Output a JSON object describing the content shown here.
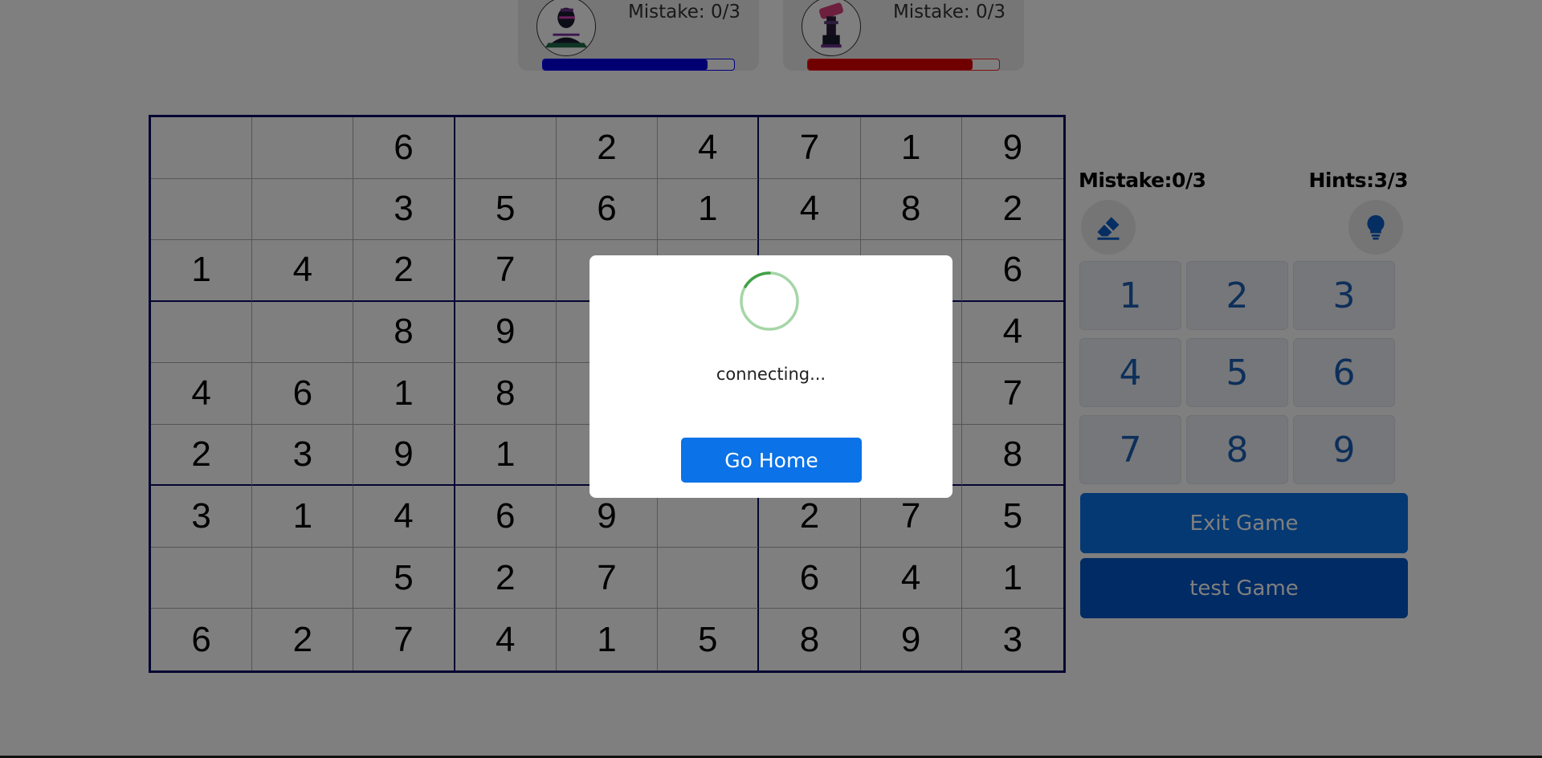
{
  "players": [
    {
      "id": "p1",
      "mistake_label": "Mistake: 0/3",
      "progress": 0.86,
      "color": "#0000e0"
    },
    {
      "id": "p2",
      "mistake_label": "Mistake: 0/3",
      "progress": 0.86,
      "color": "#e00000"
    }
  ],
  "board": {
    "rows": [
      [
        "",
        "",
        "6",
        "",
        "2",
        "4",
        "7",
        "1",
        "9"
      ],
      [
        "",
        "",
        "3",
        "5",
        "6",
        "1",
        "4",
        "8",
        "2"
      ],
      [
        "1",
        "4",
        "2",
        "7",
        "",
        "",
        "",
        "",
        "6"
      ],
      [
        "",
        "",
        "8",
        "9",
        "",
        "",
        "",
        "",
        "4"
      ],
      [
        "4",
        "6",
        "1",
        "8",
        "",
        "",
        "",
        "",
        "7"
      ],
      [
        "2",
        "3",
        "9",
        "1",
        "",
        "",
        "",
        "",
        "8"
      ],
      [
        "3",
        "1",
        "4",
        "6",
        "9",
        "",
        "2",
        "7",
        "5"
      ],
      [
        "",
        "",
        "5",
        "2",
        "7",
        "",
        "6",
        "4",
        "1"
      ],
      [
        "6",
        "2",
        "7",
        "4",
        "1",
        "5",
        "8",
        "9",
        "3"
      ]
    ]
  },
  "side": {
    "mistake_label": "Mistake:0/3",
    "hints_label": "Hints:3/3",
    "erase_icon": "eraser-icon",
    "hint_icon": "lightbulb-icon",
    "numpad": [
      "1",
      "2",
      "3",
      "4",
      "5",
      "6",
      "7",
      "8",
      "9"
    ],
    "exit_label": "Exit Game",
    "test_label": "test Game"
  },
  "dialog": {
    "message": "connecting...",
    "button_label": "Go Home",
    "spinner_color": "#4caf50"
  }
}
